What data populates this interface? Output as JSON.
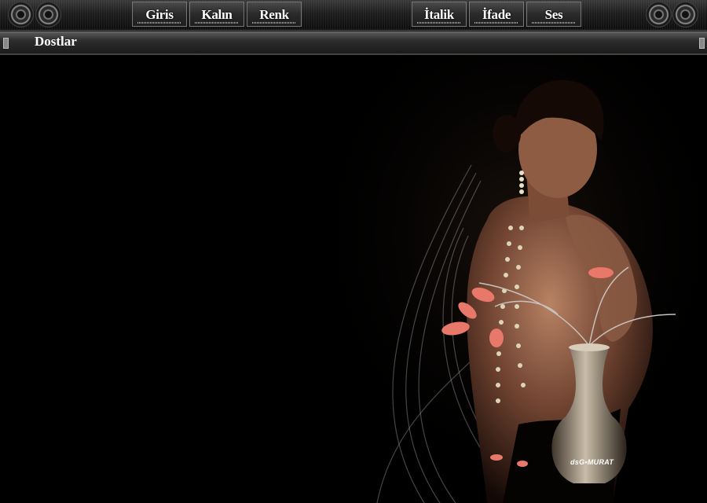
{
  "toolbar": {
    "buttons": [
      {
        "label": "Giris"
      },
      {
        "label": "Kalın"
      },
      {
        "label": "Renk"
      },
      {
        "label": "İtalik"
      },
      {
        "label": "İfade"
      },
      {
        "label": "Ses"
      }
    ]
  },
  "namebar": {
    "label": "Dostlar"
  },
  "artwork": {
    "signature": "dsG•MURAT"
  }
}
